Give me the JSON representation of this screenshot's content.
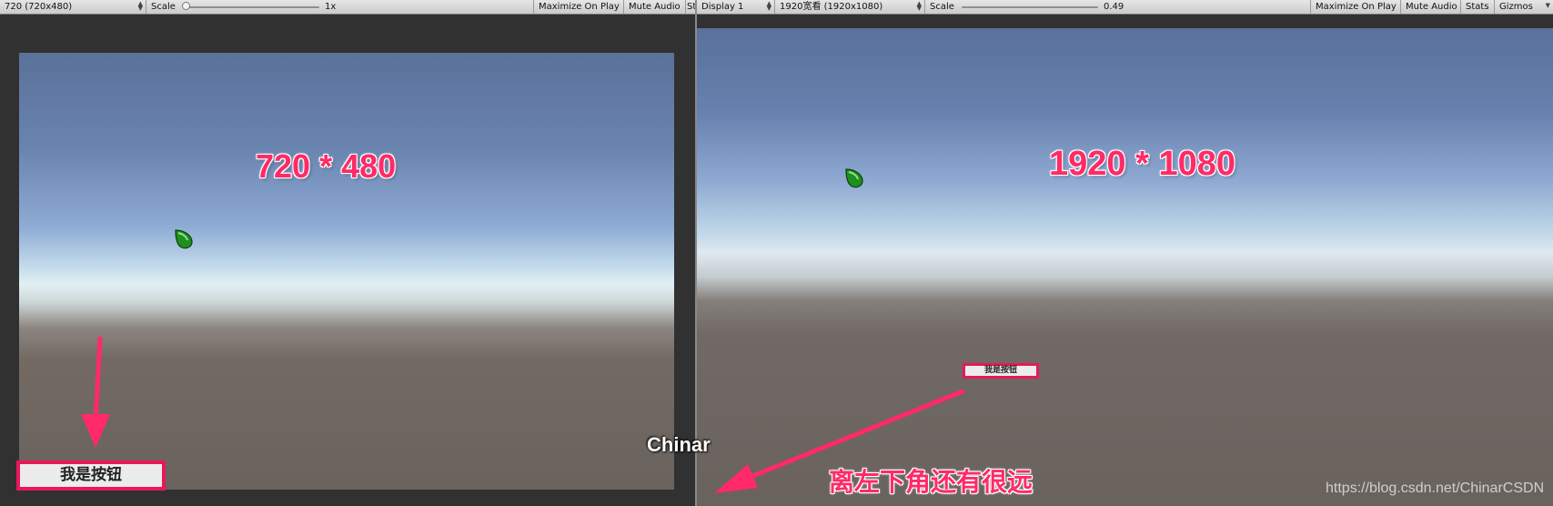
{
  "left_view": {
    "toolbar": {
      "resolution": "720 (720x480)",
      "scale_label": "Scale",
      "scale_value": "1x",
      "maximize_on_play": "Maximize On Play",
      "mute_audio": "Mute Audio",
      "stats_truncated": "St"
    },
    "resolution_text": "720 * 480",
    "button_label": "我是按钮"
  },
  "right_view": {
    "toolbar": {
      "display": "Display 1",
      "resolution": "1920宽看 (1920x1080)",
      "scale_label": "Scale",
      "scale_value": "0.49",
      "maximize_on_play": "Maximize On Play",
      "mute_audio": "Mute Audio",
      "stats": "Stats",
      "gizmos": "Gizmos"
    },
    "resolution_text": "1920 * 1080",
    "button_label": "我是按钮"
  },
  "annotations": {
    "watermark": "Chinar",
    "caption": "离左下角还有很远",
    "url": "https://blog.csdn.net/ChinarCSDN"
  },
  "colors": {
    "accent": "#e8185a",
    "toolbar": "#d9d9d9",
    "editor_background": "#313131"
  }
}
